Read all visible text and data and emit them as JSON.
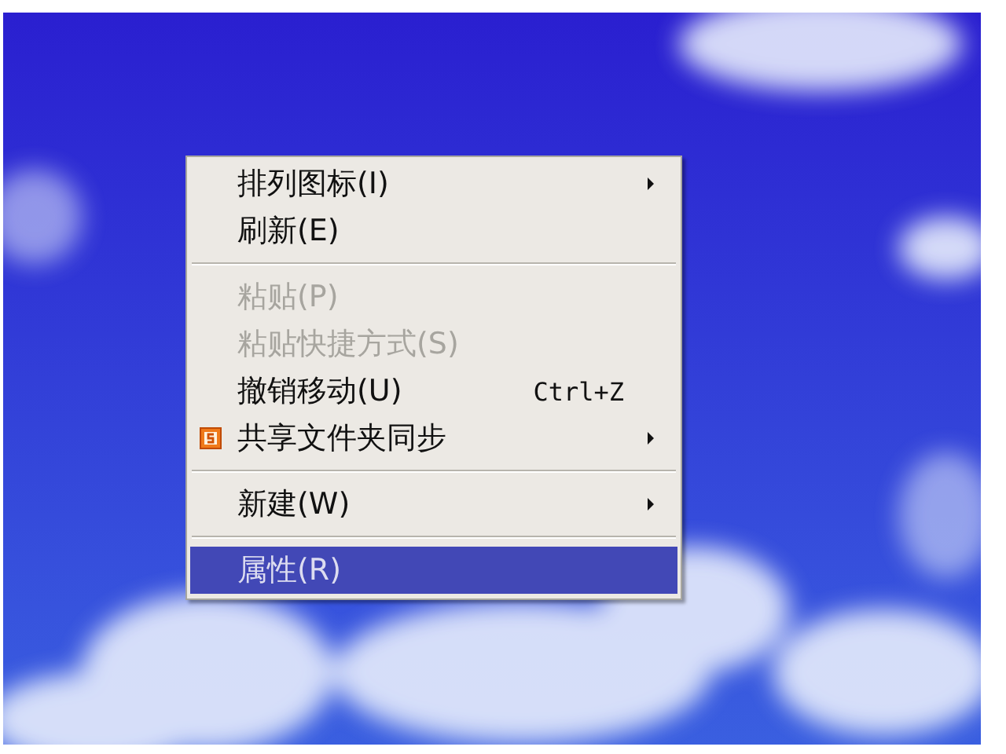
{
  "context_menu": {
    "items": [
      {
        "kind": "item",
        "label": "排列图标(I)",
        "submenu": true,
        "disabled": false,
        "selected": false,
        "icon": false
      },
      {
        "kind": "item",
        "label": "刷新(E)",
        "submenu": false,
        "disabled": false,
        "selected": false,
        "icon": false
      },
      {
        "kind": "separator"
      },
      {
        "kind": "item",
        "label": "粘贴(P)",
        "submenu": false,
        "disabled": true,
        "selected": false,
        "icon": false
      },
      {
        "kind": "item",
        "label": "粘贴快捷方式(S)",
        "submenu": false,
        "disabled": true,
        "selected": false,
        "icon": false
      },
      {
        "kind": "item",
        "label": "撤销移动(U)",
        "shortcut": "Ctrl+Z",
        "submenu": false,
        "disabled": false,
        "selected": false,
        "icon": false
      },
      {
        "kind": "item",
        "label": "共享文件夹同步",
        "submenu": true,
        "disabled": false,
        "selected": false,
        "icon": true
      },
      {
        "kind": "separator"
      },
      {
        "kind": "item",
        "label": "新建(W)",
        "submenu": true,
        "disabled": false,
        "selected": false,
        "icon": false
      },
      {
        "kind": "separator"
      },
      {
        "kind": "item",
        "label": "属性(R)",
        "submenu": false,
        "disabled": false,
        "selected": true,
        "icon": false
      }
    ]
  }
}
